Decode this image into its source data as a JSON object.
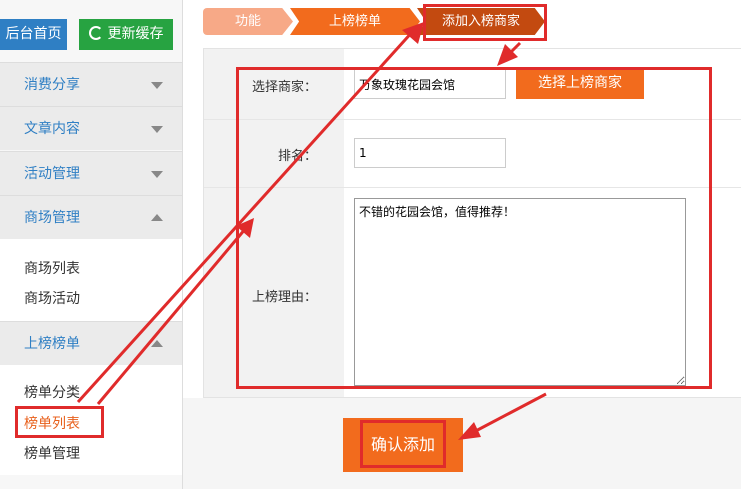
{
  "sidebar": {
    "home_button": "后台首页",
    "cache_button": "更新缓存",
    "sections": [
      {
        "label": "消费分享",
        "expanded": false
      },
      {
        "label": "文章内容",
        "expanded": false
      },
      {
        "label": "活动管理",
        "expanded": false
      },
      {
        "label": "商场管理",
        "expanded": true,
        "items": [
          "商场列表",
          "商场活动"
        ]
      },
      {
        "label": "上榜榜单",
        "expanded": true,
        "items": [
          "榜单分类",
          "榜单列表",
          "榜单管理"
        ]
      }
    ]
  },
  "breadcrumb": [
    "功能",
    "上榜榜单",
    "添加入榜商家"
  ],
  "form": {
    "merchant_label": "选择商家：",
    "merchant_value": "万象玫瑰花园会馆",
    "pick_button": "选择上榜商家",
    "rank_label": "排名：",
    "rank_value": "1",
    "reason_label": "上榜理由：",
    "reason_value": "不错的花园会馆，值得推荐！",
    "submit_button": "确认添加"
  },
  "colors": {
    "accent": "#f26b1d",
    "link_blue": "#2f7fc4",
    "green": "#27a341",
    "annotation_red": "#e02b2b"
  },
  "icons": [
    "refresh-icon",
    "chevron-down-icon",
    "chevron-up-icon"
  ]
}
